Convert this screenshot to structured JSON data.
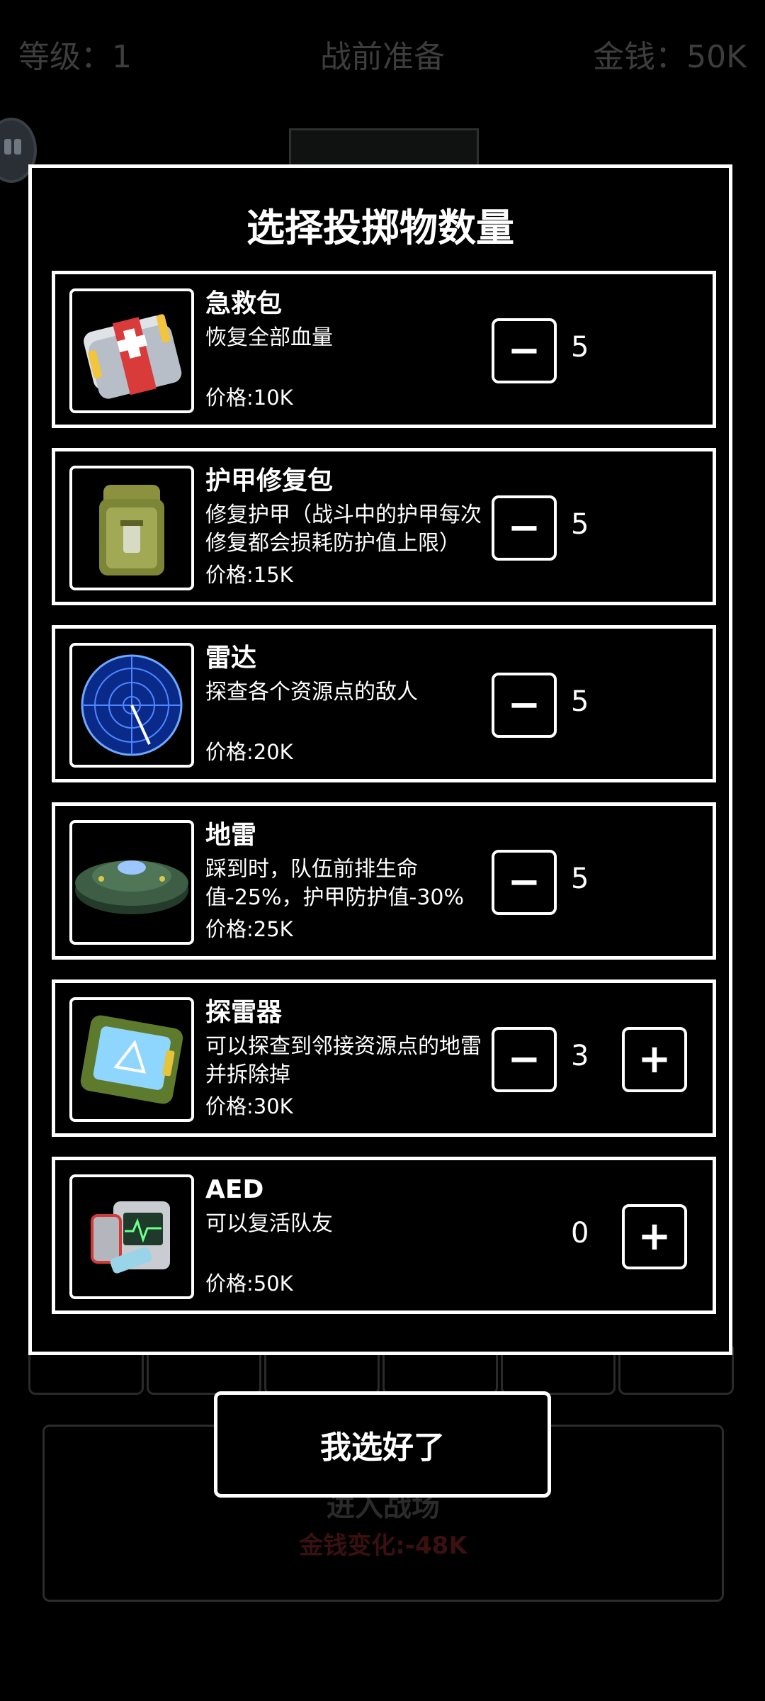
{
  "header": {
    "level": "等级：1",
    "title": "战前准备",
    "money": "金钱：50K"
  },
  "modal": {
    "title": "选择投掷物数量",
    "items": [
      {
        "name": "急救包",
        "desc": "恢复全部血量",
        "price": "价格:10K",
        "qty": "5",
        "minus": "−",
        "plus": "",
        "icon": "first-aid-kit-icon"
      },
      {
        "name": "护甲修复包",
        "desc": "修复护甲（战斗中的护甲每次修复都会损耗防护值上限）",
        "price": "价格:15K",
        "qty": "5",
        "minus": "−",
        "plus": "",
        "icon": "armor-repair-kit-icon"
      },
      {
        "name": "雷达",
        "desc": "探查各个资源点的敌人",
        "price": "价格:20K",
        "qty": "5",
        "minus": "−",
        "plus": "",
        "icon": "radar-icon"
      },
      {
        "name": "地雷",
        "desc": "踩到时，队伍前排生命值-25%，护甲防护值-30%",
        "price": "价格:25K",
        "qty": "5",
        "minus": "−",
        "plus": "",
        "icon": "landmine-icon"
      },
      {
        "name": "探雷器",
        "desc": "可以探查到邻接资源点的地雷并拆除掉",
        "price": "价格:30K",
        "qty": "3",
        "minus": "−",
        "plus": "+",
        "icon": "mine-detector-icon"
      },
      {
        "name": "AED",
        "desc": "可以复活队友",
        "price": "价格:50K",
        "qty": "0",
        "minus": "",
        "plus": "+",
        "icon": "aed-icon"
      }
    ]
  },
  "confirm_label": "我选好了",
  "background_panel": {
    "title": "进入战场",
    "money_change": "金钱变化:-48K"
  }
}
